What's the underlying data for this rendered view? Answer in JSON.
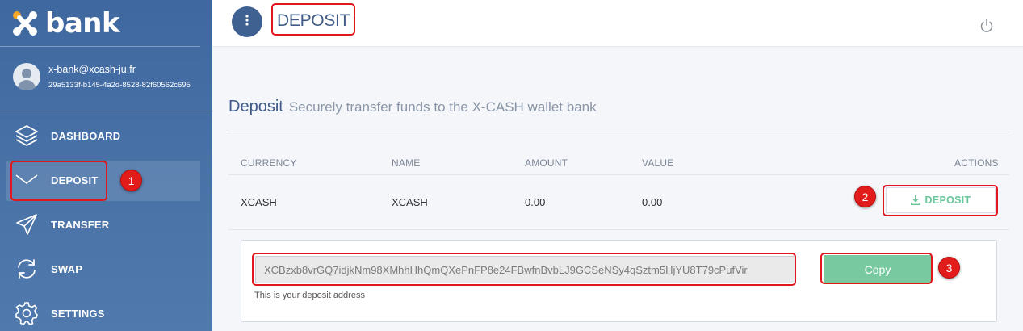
{
  "app": {
    "logo_text": "bank"
  },
  "user": {
    "email": "x-bank@xcash-ju.fr",
    "id": "29a5133f-b145-4a2d-8528-82f60562c695"
  },
  "nav": [
    {
      "label": "DASHBOARD",
      "icon": "layers-icon"
    },
    {
      "label": "DEPOSIT",
      "icon": "inbox-icon",
      "active": true
    },
    {
      "label": "TRANSFER",
      "icon": "paper-plane-icon"
    },
    {
      "label": "SWAP",
      "icon": "refresh-icon"
    },
    {
      "label": "SETTINGS",
      "icon": "gear-icon"
    }
  ],
  "header": {
    "title": "DEPOSIT"
  },
  "page": {
    "title": "Deposit",
    "subtitle": "Securely transfer funds to the X-CASH wallet bank"
  },
  "table": {
    "headers": {
      "currency": "CURRENCY",
      "name": "NAME",
      "amount": "AMOUNT",
      "value": "VALUE",
      "actions": "ACTIONS"
    },
    "rows": [
      {
        "currency": "XCASH",
        "name": "XCASH",
        "amount": "0.00",
        "value": "0.00",
        "action_label": "DEPOSIT"
      }
    ]
  },
  "deposit_panel": {
    "address": "XCBzxb8vrGQ7idjkNm98XMhhHhQmQXePnFP8e24FBwfnBvbLJ9GCSeNSy4qSztm5HjYU8T79cPufVir",
    "hint": "This is your deposit address",
    "copy_label": "Copy"
  },
  "markers": [
    "1",
    "2",
    "3"
  ],
  "colors": {
    "sidebar": "#4a73a8",
    "accent": "#3f6191",
    "copy_button": "#78c8a0",
    "deposit_text": "#6cc49a",
    "highlight": "#e0181d"
  }
}
